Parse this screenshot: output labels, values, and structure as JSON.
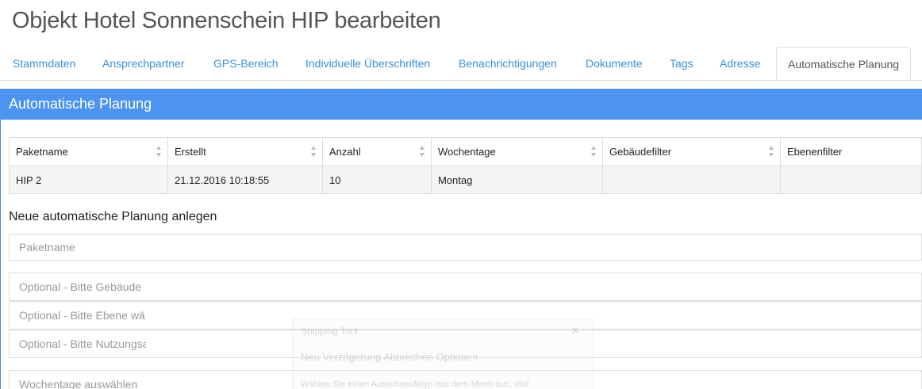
{
  "page": {
    "title": "Objekt Hotel Sonnenschein HIP bearbeiten"
  },
  "tabs": [
    {
      "label": "Stammdaten"
    },
    {
      "label": "Ansprechpartner"
    },
    {
      "label": "GPS-Bereich"
    },
    {
      "label": "Individuelle Überschriften"
    },
    {
      "label": "Benachrichtigungen"
    },
    {
      "label": "Dokumente"
    },
    {
      "label": "Tags"
    },
    {
      "label": "Adresse"
    },
    {
      "label": "Automatische Planung",
      "active": true
    }
  ],
  "panel": {
    "heading": "Automatische Planung",
    "accent_color": "#4d94f0"
  },
  "table": {
    "columns": [
      "Paketname",
      "Erstellt",
      "Anzahl",
      "Wochentage",
      "Gebäudefilter",
      "Ebenenfilter"
    ],
    "rows": [
      [
        "HIP 2",
        "21.12.2016 10:18:55",
        "10",
        "Montag",
        "",
        ""
      ]
    ]
  },
  "form": {
    "heading": "Neue automatische Planung anlegen",
    "paketname_placeholder": "Paketname",
    "gebaeude_placeholder": "Optional - Bitte Gebäude",
    "ebene_placeholder": "Optional - Bitte Ebene wä",
    "nutzung_placeholder": "Optional - Bitte Nutzungsa",
    "wochentage_placeholder": "Wochentage auswählen"
  },
  "snipping_overlay": {
    "title": "Snipping Tool",
    "toolbar": "Neu   Verzögerung   Abbrechen   Optionen",
    "hint": "Wählen Sie einen Ausschneidetyp aus dem Menü aus, und"
  }
}
